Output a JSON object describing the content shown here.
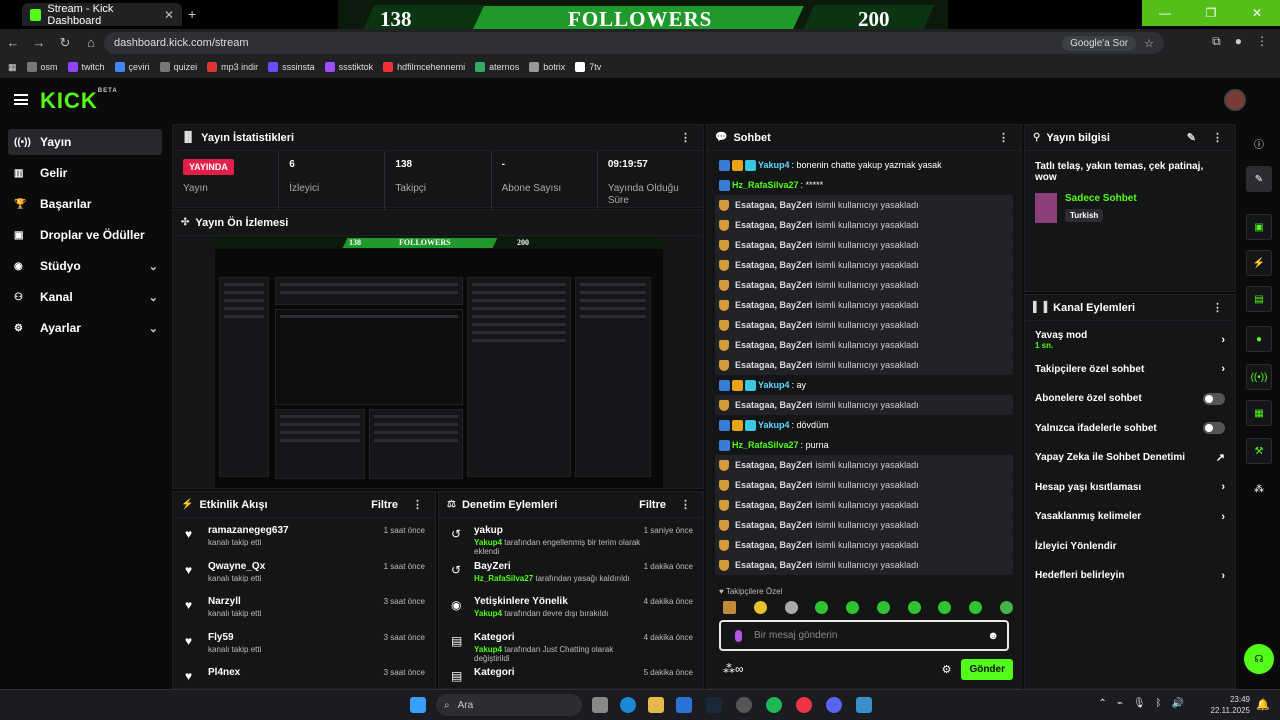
{
  "browser": {
    "tab_title": "Stream - Kick Dashboard",
    "url": "dashboard.kick.com/stream",
    "lens_label": "Google'a Sor"
  },
  "banner": {
    "count_left": "138",
    "label": "FOLLOWERS",
    "count_right": "200"
  },
  "bookmarks": [
    "osm",
    "twitch",
    "çeviri",
    "quizei",
    "mp3 indir",
    "sssinsta",
    "ssstiktok",
    "hdfilmcehennemi",
    "aternos",
    "botrix",
    "7tv"
  ],
  "kick": {
    "logo": "KICK",
    "beta": "BETA"
  },
  "sidebar": {
    "items": [
      {
        "label": "Yayın",
        "icon": "broadcast-icon"
      },
      {
        "label": "Gelir",
        "icon": "revenue-icon"
      },
      {
        "label": "Başarılar",
        "icon": "trophy-icon"
      },
      {
        "label": "Droplar ve Ödüller",
        "icon": "gift-icon"
      },
      {
        "label": "Stüdyo",
        "icon": "studio-icon"
      },
      {
        "label": "Kanal",
        "icon": "channel-icon"
      },
      {
        "label": "Ayarlar",
        "icon": "gear-icon"
      }
    ]
  },
  "stats": {
    "title": "Yayın İstatistikleri",
    "live_badge": "YAYINDA",
    "live_label": "Yayın",
    "items": [
      {
        "value": "6",
        "label": "İzleyici"
      },
      {
        "value": "138",
        "label": "Takipçi"
      },
      {
        "value": "-",
        "label": "Abone Sayısı"
      },
      {
        "value": "09:19:57",
        "label": "Yayında Olduğu Süre"
      }
    ]
  },
  "preview": {
    "title": "Yayın Ön İzlemesi",
    "mini_left": "138",
    "mini_label": "FOLLOWERS",
    "mini_right": "200"
  },
  "activity": {
    "title": "Etkinlik Akışı",
    "filter": "Filtre",
    "items": [
      {
        "name": "ramazanegeg637",
        "sub": "kanalı takip etti",
        "time": "1 saat önce"
      },
      {
        "name": "Qwayne_Qx",
        "sub": "kanalı takip etti",
        "time": "1 saat önce"
      },
      {
        "name": "Narzyll",
        "sub": "kanalı takip etti",
        "time": "3 saat önce"
      },
      {
        "name": "Fly59",
        "sub": "kanalı takip etti",
        "time": "3 saat önce"
      },
      {
        "name": "Pl4nex",
        "sub": "",
        "time": "3 saat önce"
      }
    ]
  },
  "moderation": {
    "title": "Denetim Eylemleri",
    "filter": "Filtre",
    "items": [
      {
        "name": "yakup",
        "actor": "Yakup4",
        "sub": " tarafından engellenmiş bir terim olarak eklendi",
        "time": "1 saniye önce",
        "icon": "undo-icon"
      },
      {
        "name": "BayZeri",
        "actor": "Hz_RafaSilva27",
        "sub": " tarafından yasağı kaldırıldı",
        "time": "1 dakika önce",
        "icon": "undo-icon"
      },
      {
        "name": "Yetişkinlere Yönelik",
        "actor": "Yakup4",
        "sub": " tarafından devre dışı bırakıldı",
        "time": "4 dakika önce",
        "icon": "eye-icon"
      },
      {
        "name": "Kategori",
        "actor": "Yakup4",
        "sub": " tarafından Just Chatting olarak değiştirildi",
        "time": "4 dakika önce",
        "icon": "category-icon"
      },
      {
        "name": "Kategori",
        "actor": "",
        "sub": "",
        "time": "5 dakika önce",
        "icon": "category-icon"
      }
    ]
  },
  "chat": {
    "title": "Sohbet",
    "follow_only": "Takipçilere Özel",
    "placeholder": "Bir mesaj gönderin",
    "send": "Gönder",
    "sys_users": "Esatagaa, BayZeri",
    "sys_text": "isimli kullanıcıyı yasakladı",
    "messages": [
      {
        "type": "user",
        "user": "Yakup4",
        "text": "bonenin chatte yakup yazmak yasak",
        "badges": 3
      },
      {
        "type": "user",
        "user": "Hz_RafaSilva27",
        "text": "*****",
        "badges": 1
      },
      {
        "type": "sys"
      },
      {
        "type": "sys"
      },
      {
        "type": "sys"
      },
      {
        "type": "sys"
      },
      {
        "type": "sys"
      },
      {
        "type": "sys"
      },
      {
        "type": "sys"
      },
      {
        "type": "sys"
      },
      {
        "type": "sys"
      },
      {
        "type": "user",
        "user": "Yakup4",
        "text": "ay",
        "badges": 3
      },
      {
        "type": "sys"
      },
      {
        "type": "user",
        "user": "Yakup4",
        "text": "dövdüm",
        "badges": 3
      },
      {
        "type": "user",
        "user": "Hz_RafaSilva27",
        "text": "purna",
        "badges": 1
      },
      {
        "type": "sys"
      },
      {
        "type": "sys"
      },
      {
        "type": "sys"
      },
      {
        "type": "sys"
      },
      {
        "type": "sys"
      },
      {
        "type": "sys"
      },
      {
        "type": "sys"
      }
    ]
  },
  "streaminfo": {
    "title": "Yayın bilgisi",
    "stream_title": "Tatlı telaş, yakın temas, çek patinaj, wow",
    "category": "Sadece Sohbet",
    "language": "Turkish"
  },
  "channel": {
    "title": "Kanal Eylemleri",
    "items": [
      {
        "label": "Yavaş mod",
        "sub": "1 sn.",
        "control": "arrow"
      },
      {
        "label": "Takipçilere özel sohbet",
        "sub": "",
        "control": "arrow"
      },
      {
        "label": "Abonelere özel sohbet",
        "sub": "",
        "control": "toggle"
      },
      {
        "label": "Yalnızca ifadelerle sohbet",
        "sub": "",
        "control": "toggle"
      },
      {
        "label": "Yapay Zeka ile Sohbet Denetimi",
        "sub": "",
        "control": "chart"
      },
      {
        "label": "Hesap yaşı kısıtlaması",
        "sub": "",
        "control": "arrow"
      },
      {
        "label": "Yasaklanmış kelimeler",
        "sub": "",
        "control": "arrow"
      },
      {
        "label": "İzleyici Yönlendir",
        "sub": "",
        "control": "none"
      },
      {
        "label": "Hedefleri belirleyin",
        "sub": "",
        "control": "arrow"
      }
    ]
  },
  "taskbar": {
    "search": "Ara",
    "time": "23:49",
    "date": "22.11.2025"
  },
  "colors": {
    "accent": "#53fc18",
    "live": "#e21f4b",
    "username_blue": "#5fd8ff"
  }
}
